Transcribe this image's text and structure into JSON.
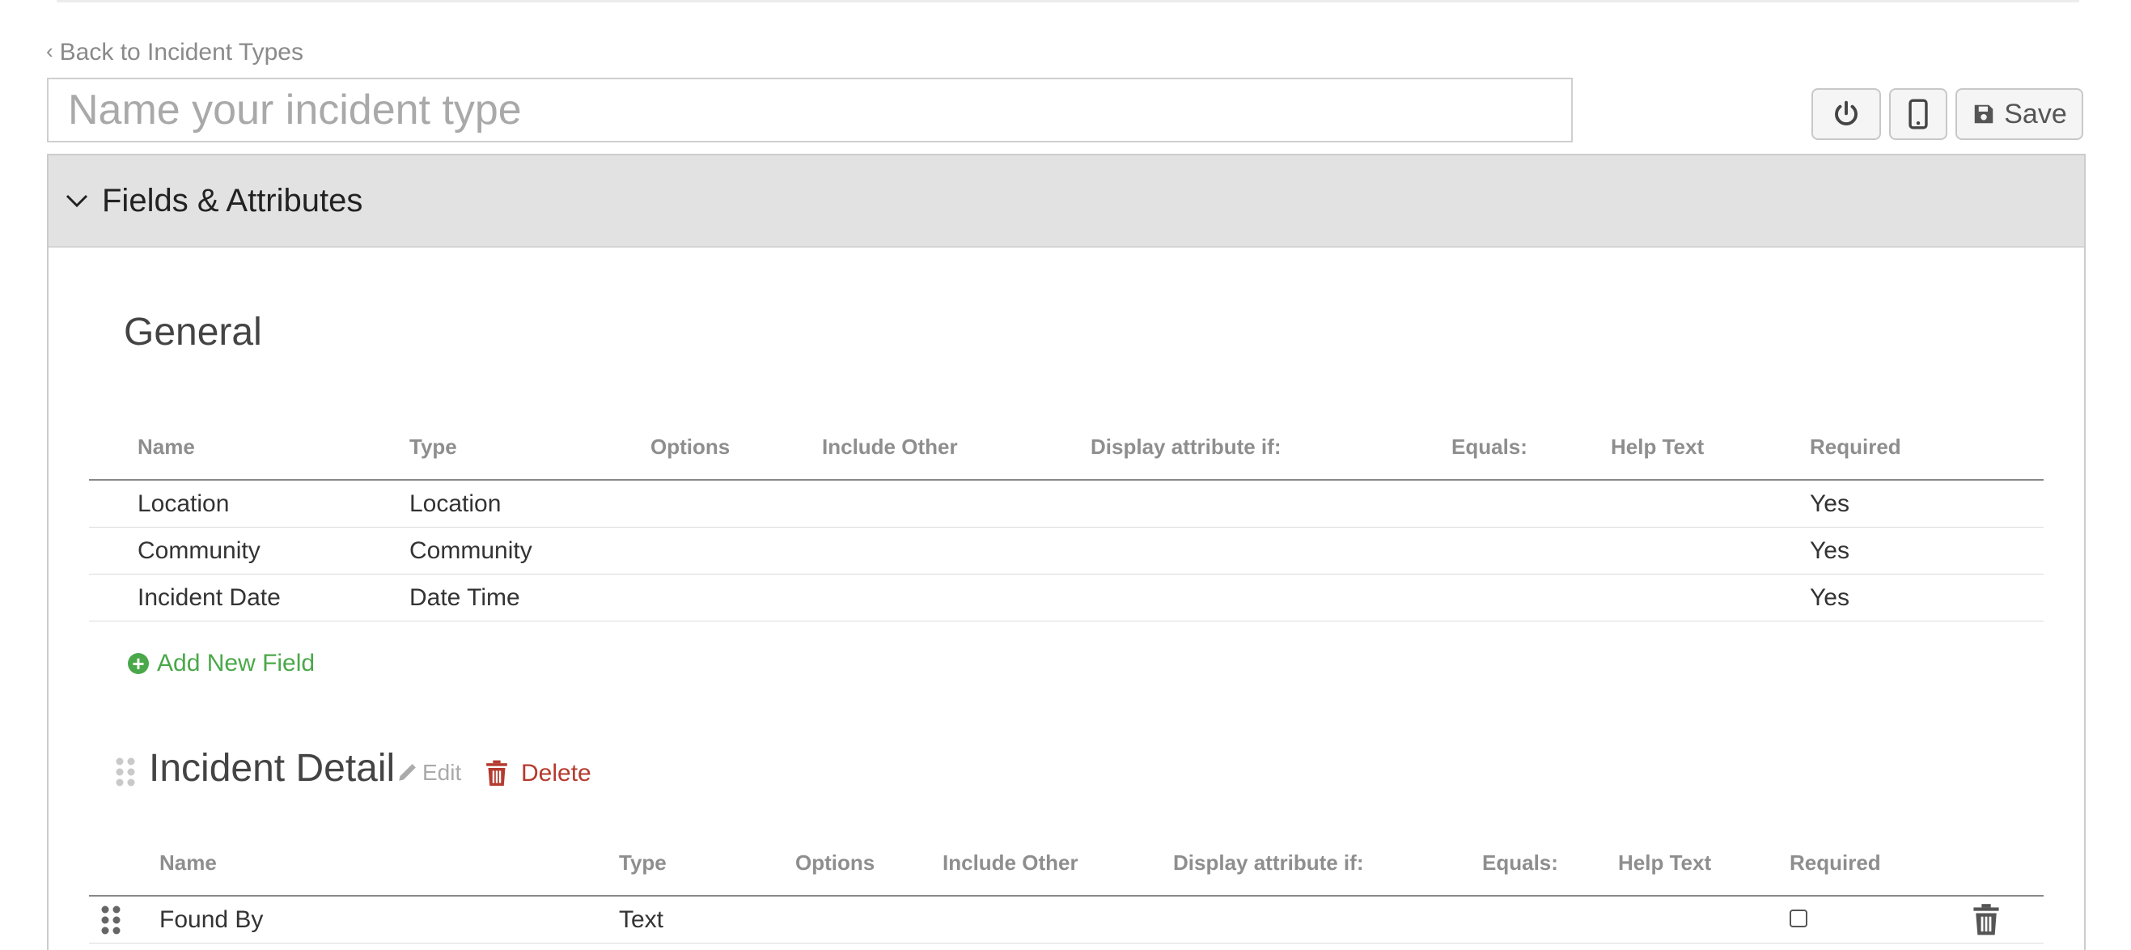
{
  "back_link": {
    "label": "Back to Incident Types"
  },
  "name_input": {
    "placeholder": "Name your incident type",
    "value": ""
  },
  "toolbar": {
    "save_label": "Save"
  },
  "panel": {
    "title": "Fields & Attributes"
  },
  "general": {
    "title": "General",
    "columns": [
      "Name",
      "Type",
      "Options",
      "Include Other",
      "Display attribute if:",
      "Equals:",
      "Help Text",
      "Required"
    ],
    "rows": [
      {
        "name": "Location",
        "type": "Location",
        "options": "",
        "include_other": "",
        "display_if": "",
        "equals": "",
        "help_text": "",
        "required": "Yes"
      },
      {
        "name": "Community",
        "type": "Community",
        "options": "",
        "include_other": "",
        "display_if": "",
        "equals": "",
        "help_text": "",
        "required": "Yes"
      },
      {
        "name": "Incident Date",
        "type": "Date Time",
        "options": "",
        "include_other": "",
        "display_if": "",
        "equals": "",
        "help_text": "",
        "required": "Yes"
      }
    ],
    "add_field_label": "Add New Field"
  },
  "incident_detail": {
    "title": "Incident Detail",
    "edit_label": "Edit",
    "delete_label": "Delete",
    "columns": [
      "Name",
      "Type",
      "Options",
      "Include Other",
      "Display attribute if:",
      "Equals:",
      "Help Text",
      "Required"
    ],
    "rows": [
      {
        "name": "Found By",
        "type": "Text",
        "options": "",
        "include_other": "",
        "display_if": "",
        "equals": "",
        "help_text": "",
        "required": false
      }
    ]
  },
  "colors": {
    "add_green": "#4aa84a",
    "delete_red": "#b53a2f",
    "panel_header_bg": "#e2e2e2"
  },
  "icons": [
    "chevron-left-icon",
    "power-icon",
    "mobile-icon",
    "save-icon",
    "chevron-down-icon",
    "plus-circle-icon",
    "drag-handle-icon",
    "pencil-icon",
    "trash-icon"
  ]
}
